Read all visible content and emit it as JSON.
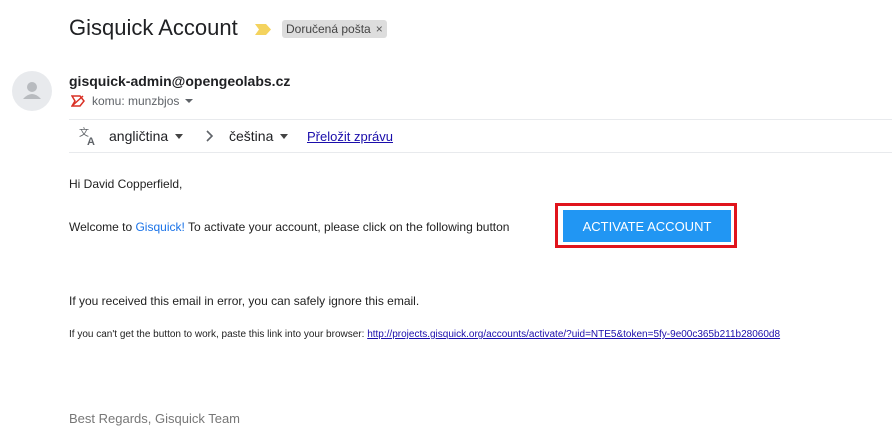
{
  "email": {
    "subject": "Gisquick Account",
    "label_chip": "Doručená pošta",
    "label_chip_close": "×",
    "sender": "gisquick-admin@opengeolabs.cz",
    "recipient": "komu: munzbjos"
  },
  "translate_bar": {
    "from_language": "angličtina",
    "to_language": "čeština",
    "translate_link": "Přeložit zprávu"
  },
  "message": {
    "greeting": "Hi David Copperfield,",
    "welcome_prefix": "Welcome to ",
    "welcome_link": "Gisquick!",
    "welcome_suffix": " To activate your account, please click on the following button",
    "activate_button": "ACTIVATE ACCOUNT",
    "error_notice": "If you received this email in error, you can safely ignore this email.",
    "fallback_prefix": "If you can't get the button to work, paste this link into your browser: ",
    "fallback_url": "http://projects.gisquick.org/accounts/activate/?uid=NTE5&token=5fy-9e00c365b211b28060d8",
    "signoff": "Best Regards, Gisquick Team"
  },
  "colors": {
    "button_bg": "#2196f3",
    "highlight_border": "#e0141c",
    "link_blue": "#1a73e8",
    "importance_yellow": "#f4d35e"
  },
  "icons": [
    "importance-marker-icon",
    "avatar-person-icon",
    "not-important-icon",
    "translate-icon",
    "chevron-right-icon",
    "dropdown-caret-icon"
  ]
}
